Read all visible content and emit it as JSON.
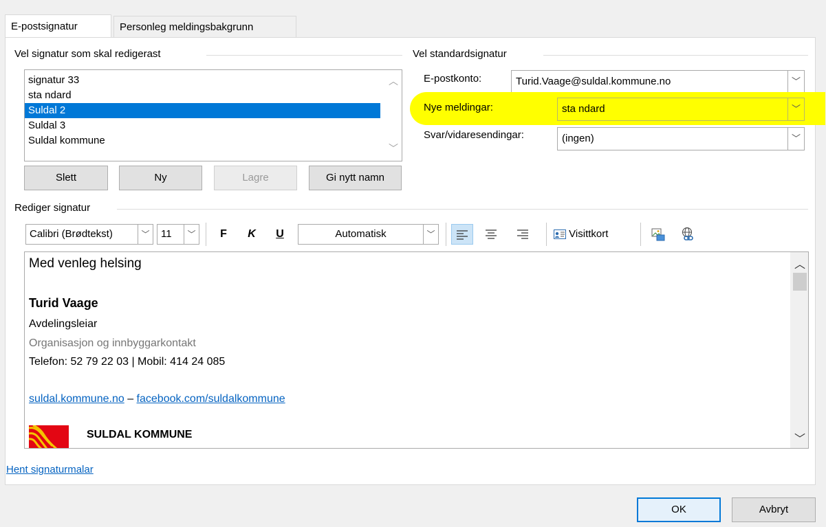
{
  "tabs": {
    "email_signature": "E-postsignatur",
    "email_signature_accel": "E",
    "personal_background": "Personleg meldingsbakgrunn",
    "personal_background_accel": "P"
  },
  "select_signature": {
    "header": "Vel signatur som skal redigerast",
    "items": [
      "signatur 33",
      "sta ndard",
      "Suldal 2",
      "Suldal 3",
      "Suldal kommune"
    ],
    "selected_index": 2
  },
  "buttons": {
    "delete": "Slett",
    "new": "Ny",
    "save": "Lagre",
    "rename": "Gi nytt namn",
    "ok": "OK",
    "cancel": "Avbryt"
  },
  "default_signature": {
    "header": "Vel standardsignatur",
    "account_label": "E-postkonto:",
    "account_value": "Turid.Vaage@suldal.kommune.no",
    "new_messages_label": "Nye meldingar:",
    "new_messages_value": "sta ndard",
    "replies_label": "Svar/vidaresendingar:",
    "replies_value": "(ingen)"
  },
  "edit_signature": {
    "header": "Rediger signatur",
    "font": "Calibri (Brødtekst)",
    "size": "11",
    "bold": "F",
    "italic": "K",
    "underline": "U",
    "color": "Automatisk",
    "business_card": "Visittkort"
  },
  "signature_content": {
    "greeting": "Med venleg helsing",
    "name": "Turid Vaage",
    "title": "Avdelingsleiar",
    "department": "Organisasjon og innbyggarkontakt",
    "phone": "Telefon: 52 79 22 03  |  Mobil: 414 24 085",
    "link1": "suldal.kommune.no",
    "separator": " – ",
    "link2": "facebook.com/suldalkommune",
    "org": "SULDAL KOMMUNE"
  },
  "templates_link": "Hent signaturmalar",
  "colors": {
    "selection": "#0078d7",
    "highlight": "#ffff00",
    "link": "#0563c1",
    "logo_red": "#e30613",
    "logo_yellow": "#f5c400"
  }
}
